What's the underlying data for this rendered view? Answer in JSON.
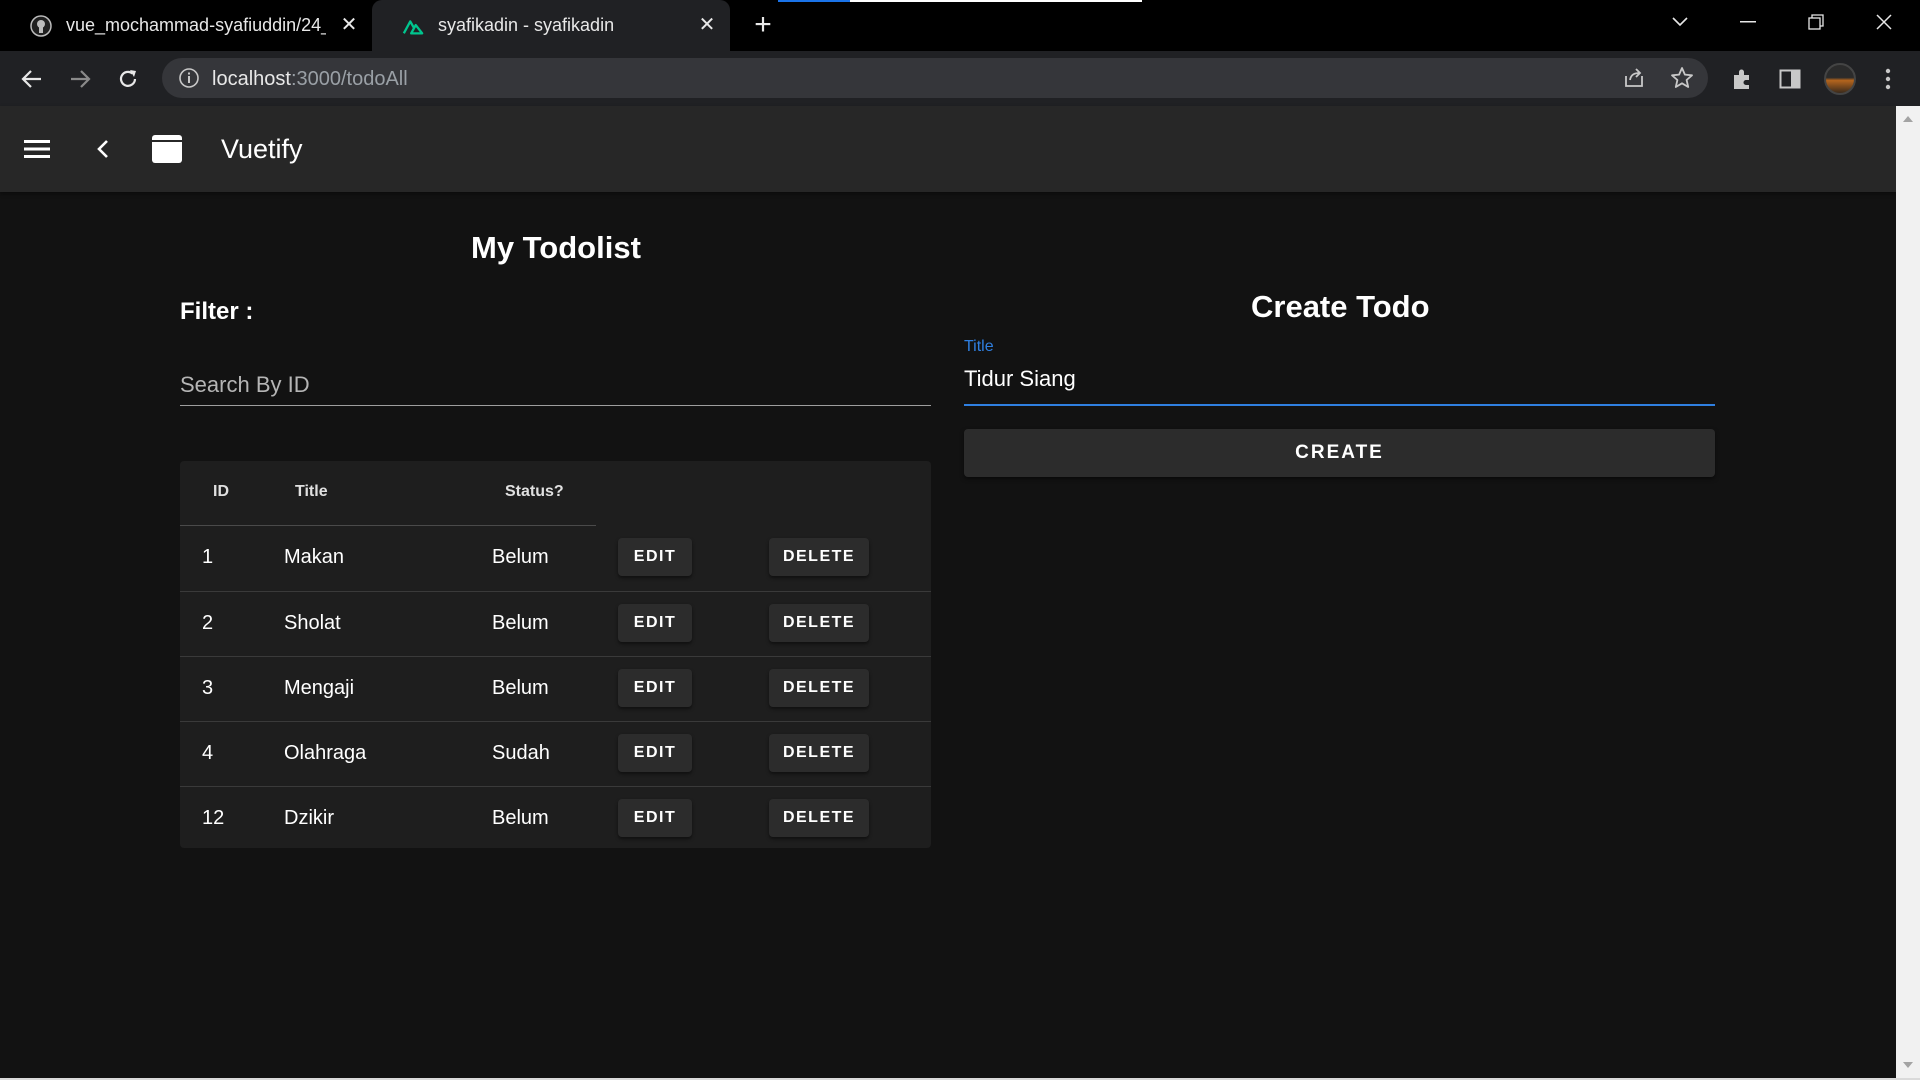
{
  "browser": {
    "tabs": [
      {
        "title": "vue_mochammad-syafiuddin/24_",
        "icon": "github-icon"
      },
      {
        "title": "syafikadin - syafikadin",
        "icon": "nuxt-icon"
      }
    ],
    "url_host": "localhost",
    "url_path": ":3000/todoAll"
  },
  "appbar": {
    "title": "Vuetify"
  },
  "todolist": {
    "heading": "My Todolist",
    "filter_label": "Filter :",
    "search_placeholder": "Search By ID",
    "columns": [
      "ID",
      "Title",
      "Status?"
    ],
    "rows": [
      {
        "id": "1",
        "title": "Makan",
        "status": "Belum"
      },
      {
        "id": "2",
        "title": "Sholat",
        "status": "Belum"
      },
      {
        "id": "3",
        "title": "Mengaji",
        "status": "Belum"
      },
      {
        "id": "4",
        "title": "Olahraga",
        "status": "Sudah"
      },
      {
        "id": "12",
        "title": "Dzikir",
        "status": "Belum"
      }
    ],
    "edit_label": "EDIT",
    "delete_label": "DELETE"
  },
  "create": {
    "heading": "Create Todo",
    "field_label": "Title",
    "field_value": "Tidur Siang",
    "button_label": "CREATE"
  },
  "colors": {
    "accent": "#2f7fe0",
    "background": "#121212",
    "appbar": "#272727"
  }
}
